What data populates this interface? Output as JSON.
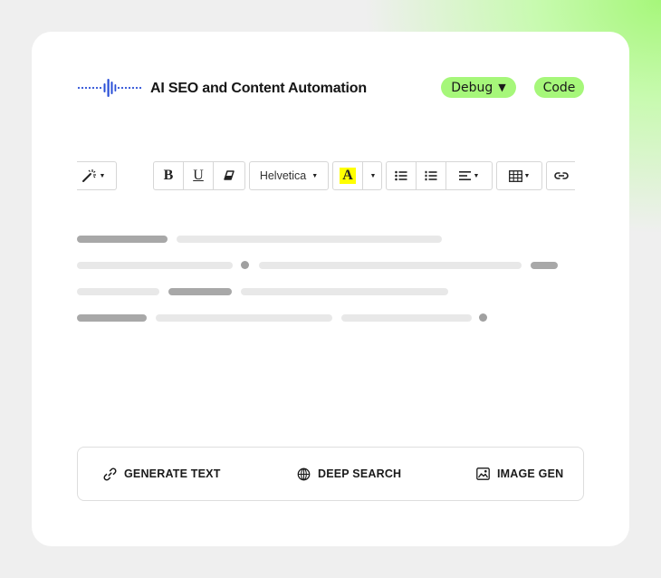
{
  "header": {
    "title": "AI SEO and Content Automation",
    "logo_icon": "sound-wave-icon",
    "debug_label": "Debug",
    "code_label": "Code"
  },
  "toolbar": {
    "font_family_value": "Helvetica",
    "bold_glyph": "B",
    "underline_glyph": "U",
    "text_color_glyph": "A",
    "icons": [
      "magic-wand-icon",
      "bold-icon",
      "underline-icon",
      "eraser-icon",
      "font-family-dropdown",
      "text-color-icon",
      "bullet-list-icon",
      "numbered-list-icon",
      "align-icon",
      "table-icon",
      "link-icon",
      "image-icon"
    ]
  },
  "actions": {
    "generate_text": "GENERATE TEXT",
    "deep_search": "DEEP SEARCH",
    "image_gen": "IMAGE GEN"
  },
  "colors": {
    "accent_green": "#a6f77a",
    "logo_blue": "#2a4fd7",
    "highlight_yellow": "#ffff00"
  }
}
